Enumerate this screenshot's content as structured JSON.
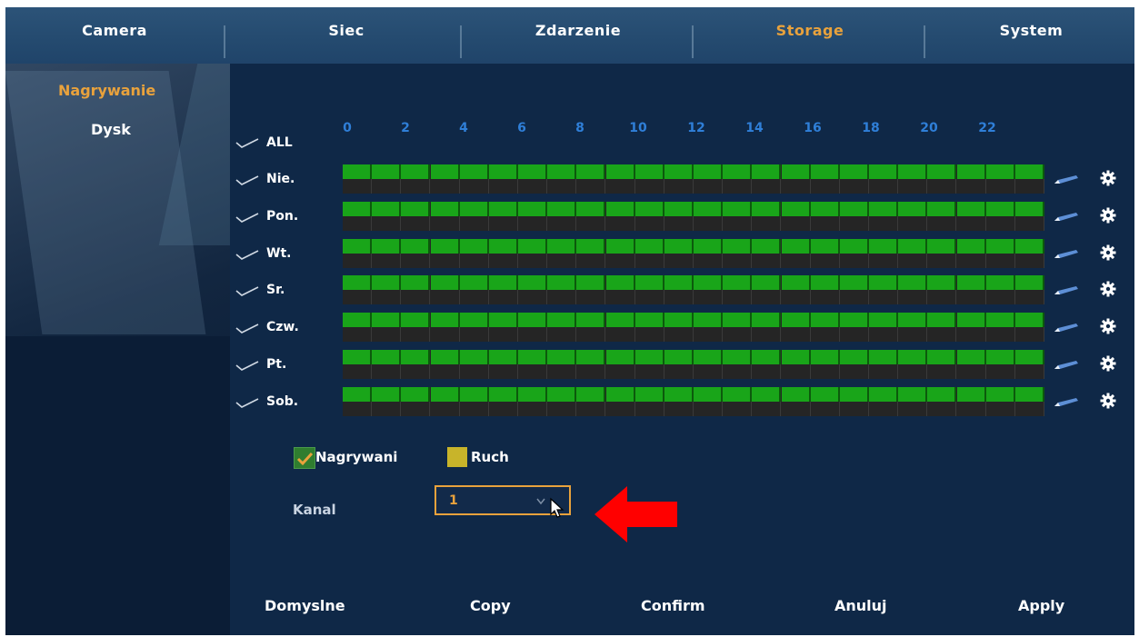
{
  "tabs": [
    {
      "label": "Camera",
      "active": false
    },
    {
      "label": "Siec",
      "active": false
    },
    {
      "label": "Zdarzenie",
      "active": false
    },
    {
      "label": "Storage",
      "active": true
    },
    {
      "label": "System",
      "active": false
    }
  ],
  "sidebar": [
    {
      "label": "Nagrywanie",
      "active": true
    },
    {
      "label": "Dysk",
      "active": false
    }
  ],
  "schedule": {
    "all_label": "ALL",
    "hours": [
      "0",
      "2",
      "4",
      "6",
      "8",
      "10",
      "12",
      "14",
      "16",
      "18",
      "20",
      "22"
    ],
    "days": [
      "Nie.",
      "Pon.",
      "Wt.",
      "Sr.",
      "Czw.",
      "Pt.",
      "Sob."
    ],
    "segments_per_day": 24
  },
  "legend": {
    "record_label": "Nagrywani",
    "motion_label": "Ruch",
    "record_color": "#19a519",
    "motion_color": "#c8b42a"
  },
  "channel": {
    "label": "Kanal",
    "value": "1"
  },
  "bottom_buttons": [
    "Domyslne",
    "Copy",
    "Confirm",
    "Anuluj",
    "Apply"
  ],
  "colors": {
    "accent": "#e9a23c",
    "record_green": "#19a519",
    "hour_blue": "#2f7fd8",
    "annotation_arrow": "#ff0000"
  },
  "icons": {
    "row_edit": "pencil-icon",
    "row_settings": "gear-icon",
    "check": "checkmark-icon",
    "cursor": "mouse-pointer-icon",
    "annotation": "red-arrow-icon"
  }
}
